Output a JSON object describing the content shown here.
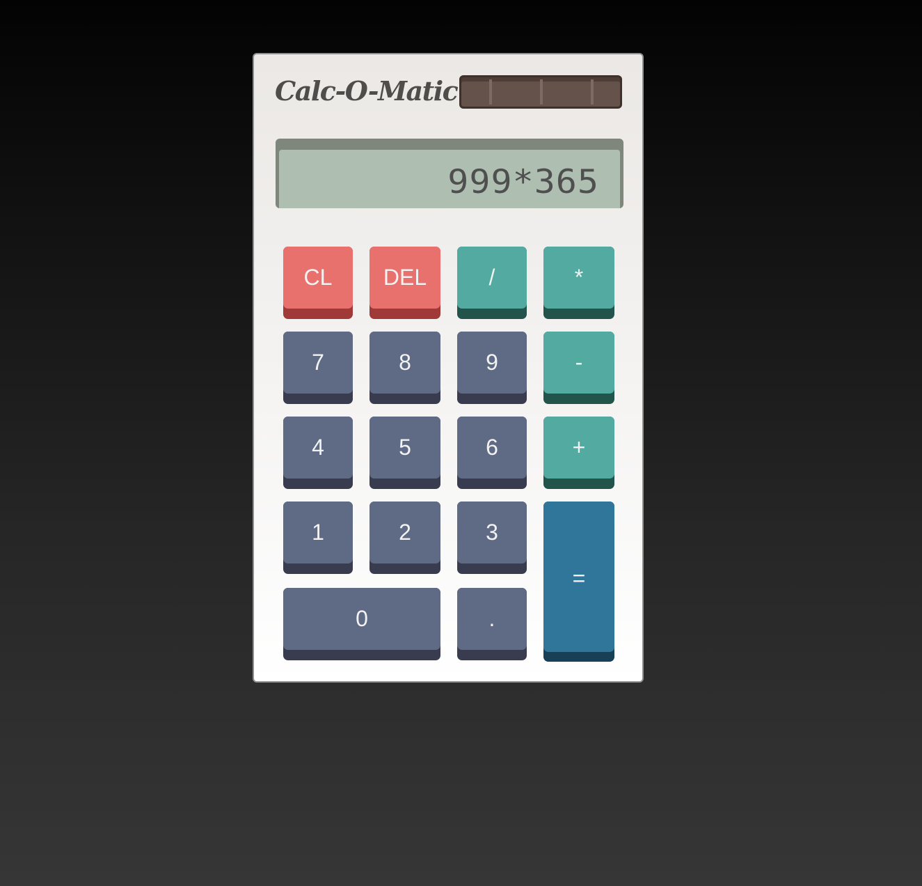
{
  "brand": "Calc-O-Matic",
  "display": "999*365",
  "keys": {
    "clear": "CL",
    "delete": "DEL",
    "divide": "/",
    "multiply": "*",
    "subtract": "-",
    "add": "+",
    "equals": "=",
    "decimal": ".",
    "d0": "0",
    "d1": "1",
    "d2": "2",
    "d3": "3",
    "d4": "4",
    "d5": "5",
    "d6": "6",
    "d7": "7",
    "d8": "8",
    "d9": "9"
  },
  "colors": {
    "function_key": "#e8716d",
    "operator_key": "#52aaa0",
    "digit_key": "#5f6a84",
    "equals_key": "#30769a",
    "display_bg": "#aebfb1"
  }
}
